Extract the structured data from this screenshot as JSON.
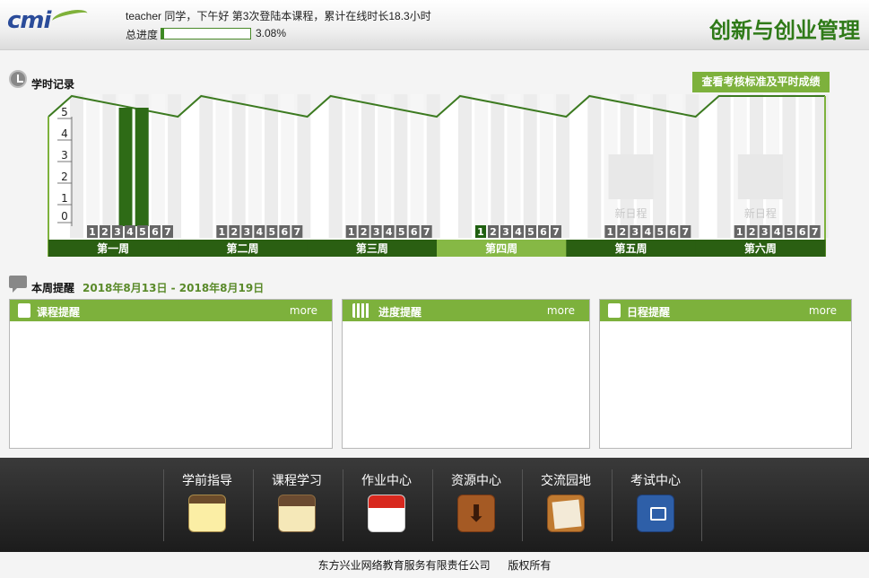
{
  "header": {
    "logo_text": "cmi",
    "greeting": "teacher 同学，下午好 第3次登陆本课程，累计在线时长18.3小时",
    "progress_label": "总进度",
    "progress_percent": "3.08%",
    "progress_value": 3.08,
    "course_title": "创新与创业管理"
  },
  "study_record": {
    "title": "学时记录",
    "button_label": "查看考核标准及平时成绩",
    "y_ticks": [
      "0",
      "1",
      "2",
      "3",
      "4",
      "5"
    ],
    "weeks": [
      {
        "label": "第一周",
        "active": false,
        "new_schedule": false,
        "days": [
          "1",
          "2",
          "3",
          "4",
          "5",
          "6",
          "7"
        ],
        "hours": [
          0,
          0,
          0,
          5,
          5,
          0,
          0
        ]
      },
      {
        "label": "第二周",
        "active": false,
        "new_schedule": false,
        "days": [
          "1",
          "2",
          "3",
          "4",
          "5",
          "6",
          "7"
        ],
        "hours": [
          0,
          0,
          0,
          0,
          0,
          0,
          0
        ]
      },
      {
        "label": "第三周",
        "active": false,
        "new_schedule": false,
        "days": [
          "1",
          "2",
          "3",
          "4",
          "5",
          "6",
          "7"
        ],
        "hours": [
          0,
          0,
          0,
          0,
          0,
          0,
          0
        ]
      },
      {
        "label": "第四周",
        "active": true,
        "new_schedule": false,
        "days": [
          "1",
          "2",
          "3",
          "4",
          "5",
          "6",
          "7"
        ],
        "hours": [
          0,
          0,
          0,
          0,
          0,
          0,
          0
        ],
        "today_index": 0
      },
      {
        "label": "第五周",
        "active": false,
        "new_schedule": true,
        "days": [
          "1",
          "2",
          "3",
          "4",
          "5",
          "6",
          "7"
        ],
        "hours": [
          0,
          0,
          0,
          0,
          0,
          0,
          0
        ]
      },
      {
        "label": "第六周",
        "active": false,
        "new_schedule": true,
        "days": [
          "1",
          "2",
          "3",
          "4",
          "5",
          "6",
          "7"
        ],
        "hours": [
          0,
          0,
          0,
          0,
          0,
          0,
          0
        ]
      }
    ],
    "new_schedule_label": "新日程"
  },
  "reminders": {
    "title": "本周提醒",
    "date_range": "2018年8月13日 - 2018年8月19日",
    "panels": [
      {
        "title": "课程提醒",
        "more": "more"
      },
      {
        "title": "进度提醒",
        "more": "more"
      },
      {
        "title": "日程提醒",
        "more": "more"
      }
    ]
  },
  "nav": {
    "items": [
      {
        "label": "学前指导",
        "icon": "notepad-icon"
      },
      {
        "label": "课程学习",
        "icon": "notebook-icon"
      },
      {
        "label": "作业中心",
        "icon": "calendar-icon"
      },
      {
        "label": "资源中心",
        "icon": "download-icon"
      },
      {
        "label": "交流园地",
        "icon": "chat-icon"
      },
      {
        "label": "考试中心",
        "icon": "exam-icon"
      }
    ]
  },
  "footer": {
    "company": "东方兴业网络教育服务有限责任公司",
    "rights": "版权所有"
  },
  "colors": {
    "brand_green": "#7db13c",
    "dark_green": "#2a6a12",
    "title_green": "#2f7a18"
  }
}
